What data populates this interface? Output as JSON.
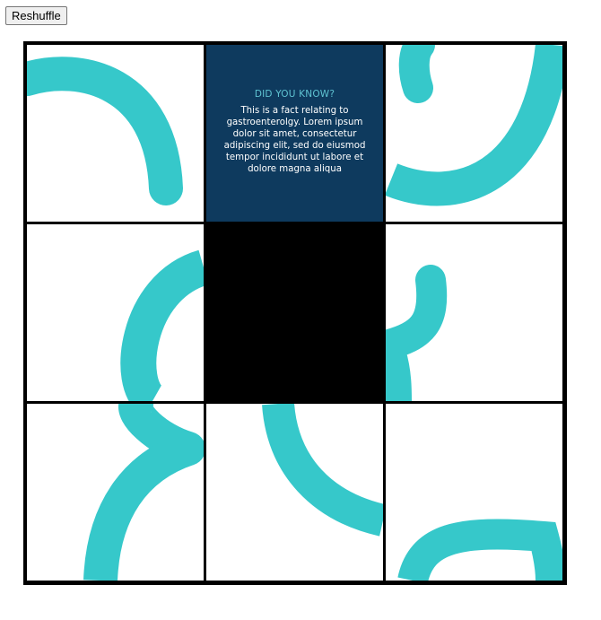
{
  "controls": {
    "reshuffle_label": "Reshuffle"
  },
  "puzzle": {
    "accent_color": "#36c8ca",
    "fact_background": "#0e3a5e",
    "grid": "3x3",
    "empty_tile": "row 2, column 2",
    "fact_tile": {
      "title": "DID YOU KNOW?",
      "text": "This is a fact relating to gastroenterolgy. Lorem ipsum dolor sit amet, consectetur adipiscing elit, sed do eiusmod tempor incididunt ut labore et dolore magna aliqua"
    }
  }
}
